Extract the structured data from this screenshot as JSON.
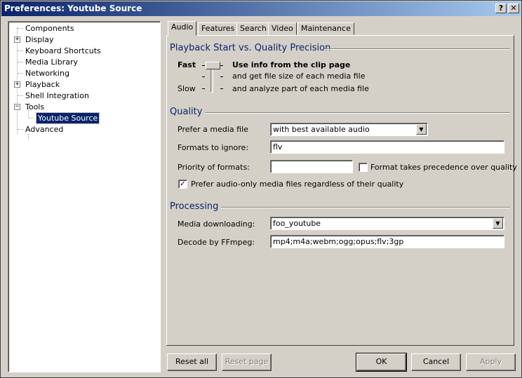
{
  "window": {
    "title": "Preferences: Youtube Source",
    "help_glyph": "?",
    "close_glyph": "✕"
  },
  "tree": {
    "items": [
      {
        "label": "Components",
        "expander": ""
      },
      {
        "label": "Display",
        "expander": "+"
      },
      {
        "label": "Keyboard Shortcuts",
        "expander": ""
      },
      {
        "label": "Media Library",
        "expander": ""
      },
      {
        "label": "Networking",
        "expander": ""
      },
      {
        "label": "Playback",
        "expander": "+"
      },
      {
        "label": "Shell Integration",
        "expander": ""
      },
      {
        "label": "Tools",
        "expander": "−"
      },
      {
        "label": "Youtube Source",
        "expander": ""
      },
      {
        "label": "Advanced",
        "expander": ""
      }
    ],
    "selected": "Youtube Source"
  },
  "tabs": [
    "Audio",
    "Features",
    "Search",
    "Video",
    "Maintenance"
  ],
  "active_tab": "Audio",
  "playback": {
    "title": "Playback Start vs. Quality Precision",
    "fast_label": "Fast",
    "slow_label": "Slow",
    "options": [
      "Use info from the clip page",
      "and get file size of each media file",
      "and analyze part of each media file"
    ],
    "slider_level": 0
  },
  "quality": {
    "title": "Quality",
    "prefer_label": "Prefer a media file",
    "prefer_value": "with best available audio",
    "ignore_label": "Formats to ignore:",
    "ignore_value": "flv",
    "priority_label": "Priority of formats:",
    "priority_value": "",
    "precedence_label": "Format takes precedence over quality",
    "precedence_checked": false,
    "audio_only_label": "Prefer audio-only media files regardless of their quality",
    "audio_only_checked": true,
    "check_glyph": "✓"
  },
  "processing": {
    "title": "Processing",
    "download_label": "Media downloading:",
    "download_value": "foo_youtube",
    "ffmpeg_label": "Decode by FFmpeg:",
    "ffmpeg_value": "mp4;m4a;webm;ogg;opus;flv;3gp"
  },
  "buttons": {
    "reset_all": "Reset all",
    "reset_page": "Reset page",
    "ok": "OK",
    "cancel": "Cancel",
    "apply": "Apply"
  },
  "combo_arrow": "▼"
}
